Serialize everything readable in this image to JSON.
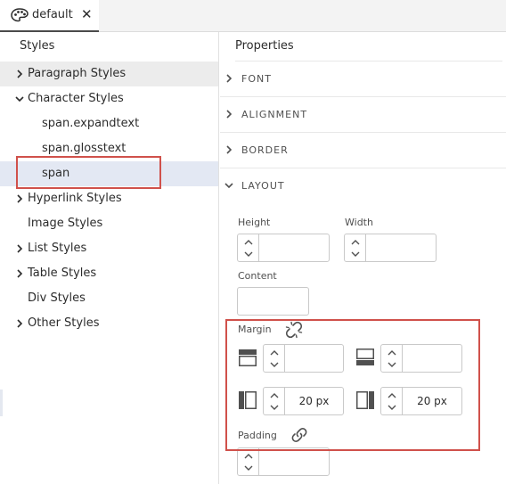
{
  "tab": {
    "label": "default",
    "close": "✕"
  },
  "styles_panel": {
    "header": "Styles",
    "items": [
      {
        "label": "Paragraph Styles"
      },
      {
        "label": "Character Styles"
      },
      {
        "label": "span.expandtext"
      },
      {
        "label": "span.glosstext"
      },
      {
        "label": "span"
      },
      {
        "label": "Hyperlink Styles"
      },
      {
        "label": "Image Styles"
      },
      {
        "label": "List Styles"
      },
      {
        "label": "Table Styles"
      },
      {
        "label": "Div Styles"
      },
      {
        "label": "Other Styles"
      }
    ]
  },
  "properties_panel": {
    "header": "Properties",
    "sections": [
      {
        "label": "FONT"
      },
      {
        "label": "ALIGNMENT"
      },
      {
        "label": "BORDER"
      },
      {
        "label": "LAYOUT"
      }
    ],
    "layout": {
      "height_label": "Height",
      "height_value": "",
      "width_label": "Width",
      "width_value": "",
      "content_label": "Content",
      "content_value": "",
      "margin_label": "Margin",
      "margin_top": "",
      "margin_bottom": "",
      "margin_left": "20 px",
      "margin_right": "20 px",
      "padding_label": "Padding",
      "padding_value": ""
    }
  },
  "colors": {
    "highlight_box": "#d0514b",
    "selected_row": "#e3e8f3",
    "hover_row": "#ececec"
  }
}
